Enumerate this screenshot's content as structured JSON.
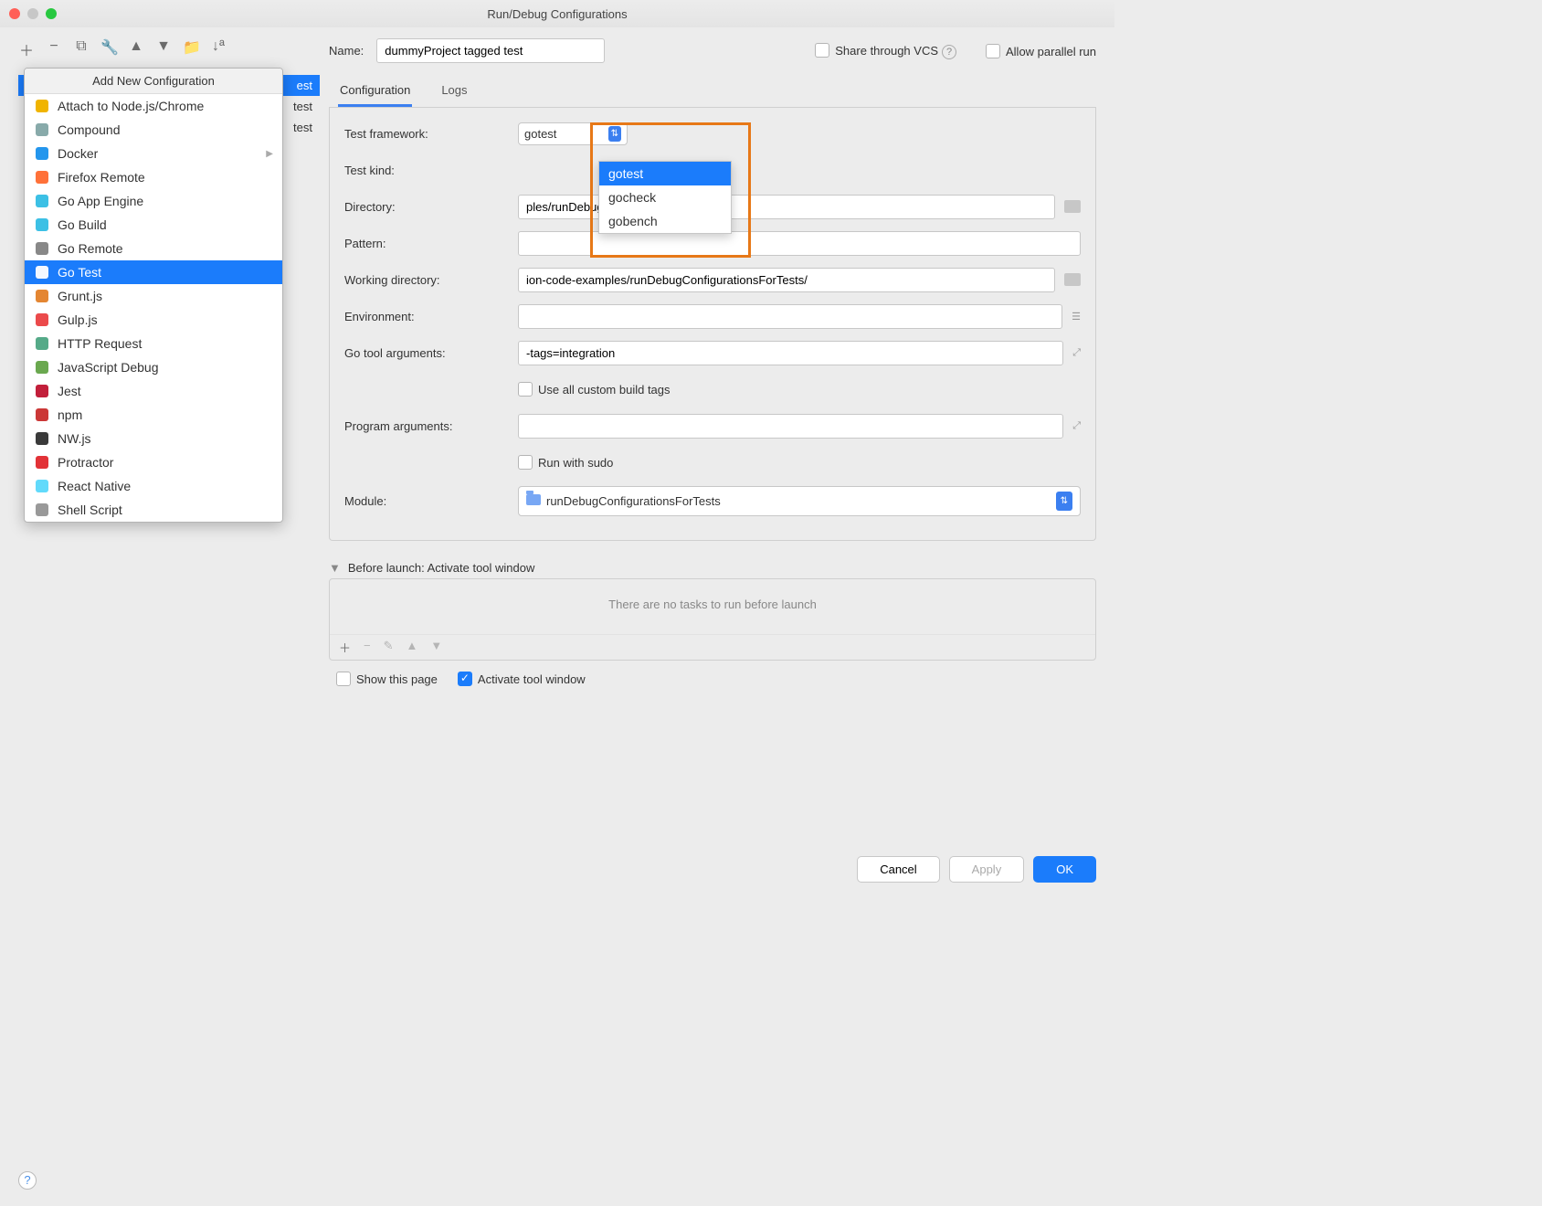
{
  "window": {
    "title": "Run/Debug Configurations"
  },
  "sidebar": {
    "existing": [
      {
        "label": "est",
        "selected": true
      },
      {
        "label": "test"
      },
      {
        "label": "test"
      }
    ]
  },
  "popup": {
    "title": "Add New Configuration",
    "items": [
      {
        "label": "Attach to Node.js/Chrome",
        "icon": "js-icon"
      },
      {
        "label": "Compound",
        "icon": "compound-icon"
      },
      {
        "label": "Docker",
        "icon": "docker-icon",
        "submenu": true
      },
      {
        "label": "Firefox Remote",
        "icon": "firefox-icon"
      },
      {
        "label": "Go App Engine",
        "icon": "gopher-icon"
      },
      {
        "label": "Go Build",
        "icon": "gopher-icon"
      },
      {
        "label": "Go Remote",
        "icon": "remote-icon"
      },
      {
        "label": "Go Test",
        "icon": "gopher-icon",
        "selected": true
      },
      {
        "label": "Grunt.js",
        "icon": "grunt-icon"
      },
      {
        "label": "Gulp.js",
        "icon": "gulp-icon"
      },
      {
        "label": "HTTP Request",
        "icon": "http-icon"
      },
      {
        "label": "JavaScript Debug",
        "icon": "jsdebug-icon"
      },
      {
        "label": "Jest",
        "icon": "jest-icon"
      },
      {
        "label": "npm",
        "icon": "npm-icon"
      },
      {
        "label": "NW.js",
        "icon": "nwjs-icon"
      },
      {
        "label": "Protractor",
        "icon": "protractor-icon"
      },
      {
        "label": "React Native",
        "icon": "react-icon"
      },
      {
        "label": "Shell Script",
        "icon": "shell-icon"
      }
    ]
  },
  "name_row": {
    "label": "Name:",
    "value": "dummyProject tagged test",
    "share_label": "Share through VCS",
    "allow_label": "Allow parallel run"
  },
  "tabs": {
    "active": "Configuration",
    "other": "Logs"
  },
  "form": {
    "test_framework_label": "Test framework:",
    "test_framework_value": "gotest",
    "test_framework_options": [
      "gotest",
      "gocheck",
      "gobench"
    ],
    "test_kind_label": "Test kind:",
    "directory_label": "Directory:",
    "directory_value": "ples/runDebugConfigurationsForTests/",
    "pattern_label": "Pattern:",
    "pattern_value": "",
    "working_label": "Working directory:",
    "working_value": "ion-code-examples/runDebugConfigurationsForTests/",
    "env_label": "Environment:",
    "env_value": "",
    "go_tool_label": "Go tool arguments:",
    "go_tool_value": "-tags=integration",
    "use_tags_label": "Use all custom build tags",
    "program_label": "Program arguments:",
    "program_value": "",
    "sudo_label": "Run with sudo",
    "module_label": "Module:",
    "module_value": "runDebugConfigurationsForTests"
  },
  "before_launch": {
    "header": "Before launch: Activate tool window",
    "empty": "There are no tasks to run before launch"
  },
  "footer": {
    "show_page": "Show this page",
    "activate": "Activate tool window"
  },
  "buttons": {
    "cancel": "Cancel",
    "apply": "Apply",
    "ok": "OK"
  }
}
